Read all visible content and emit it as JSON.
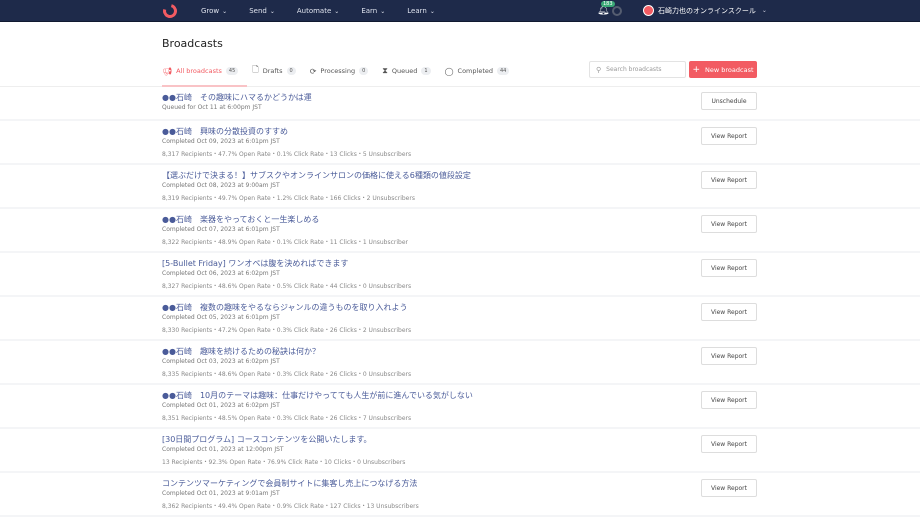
{
  "nav": {
    "items": [
      "Grow",
      "Send",
      "Automate",
      "Earn",
      "Learn"
    ],
    "notification_count": "183",
    "user_name": "石崎力也のオンラインスクール"
  },
  "page": {
    "title": "Broadcasts"
  },
  "tabs": [
    {
      "label": "All broadcasts",
      "count": "45",
      "icon": "megaphone-icon"
    },
    {
      "label": "Drafts",
      "count": "0",
      "icon": "document-icon"
    },
    {
      "label": "Processing",
      "count": "0",
      "icon": "refresh-icon"
    },
    {
      "label": "Queued",
      "count": "1",
      "icon": "hourglass-icon"
    },
    {
      "label": "Completed",
      "count": "44",
      "icon": "check-circle-icon"
    }
  ],
  "search": {
    "placeholder": "Search broadcasts"
  },
  "new_button": "New broadcast",
  "accent": "#f25b62",
  "broadcasts": [
    {
      "title": "●●石崎　その趣味にハマるかどうかは運",
      "status": "Queued for Oct 11 at 6:00pm JST",
      "stats": "",
      "action": "Unschedule"
    },
    {
      "title": "●●石崎　興味の分散投資のすすめ",
      "status": "Completed Oct 09, 2023 at 6:01pm JST",
      "stats": "8,317 Recipients・47.7% Open Rate・0.1% Click Rate・13 Clicks・5 Unsubscribers",
      "action": "View Report"
    },
    {
      "title": "【選ぶだけで決まる！】サブスクやオンラインサロンの価格に使える6種類の値段設定",
      "status": "Completed Oct 08, 2023 at 9:00am JST",
      "stats": "8,319 Recipients・49.7% Open Rate・1.2% Click Rate・166 Clicks・2 Unsubscribers",
      "action": "View Report"
    },
    {
      "title": "●●石崎　楽器をやっておくと一生楽しめる",
      "status": "Completed Oct 07, 2023 at 6:01pm JST",
      "stats": "8,322 Recipients・48.9% Open Rate・0.1% Click Rate・11 Clicks・1 Unsubscriber",
      "action": "View Report"
    },
    {
      "title": "[5-Bullet Friday] ワンオペは腹を決めればできます",
      "status": "Completed Oct 06, 2023 at 6:02pm JST",
      "stats": "8,327 Recipients・48.6% Open Rate・0.5% Click Rate・44 Clicks・0 Unsubscribers",
      "action": "View Report"
    },
    {
      "title": "●●石崎　複数の趣味をやるならジャンルの違うものを取り入れよう",
      "status": "Completed Oct 05, 2023 at 6:01pm JST",
      "stats": "8,330 Recipients・47.2% Open Rate・0.3% Click Rate・26 Clicks・2 Unsubscribers",
      "action": "View Report"
    },
    {
      "title": "●●石崎　趣味を続けるための秘訣は何か？",
      "status": "Completed Oct 03, 2023 at 6:02pm JST",
      "stats": "8,335 Recipients・48.6% Open Rate・0.3% Click Rate・26 Clicks・0 Unsubscribers",
      "action": "View Report"
    },
    {
      "title": "●●石崎　10月のテーマは趣味：仕事だけやってても人生が前に進んでいる気がしない",
      "status": "Completed Oct 01, 2023 at 6:02pm JST",
      "stats": "8,351 Recipients・48.5% Open Rate・0.3% Click Rate・26 Clicks・7 Unsubscribers",
      "action": "View Report"
    },
    {
      "title": "[30日間プログラム] コースコンテンツを公開いたします。",
      "status": "Completed Oct 01, 2023 at 12:00pm JST",
      "stats": "13 Recipients・92.3% Open Rate・76.9% Click Rate・10 Clicks・0 Unsubscribers",
      "action": "View Report"
    },
    {
      "title": "コンテンツマーケティングで会員制サイトに集客し売上につなげる方法",
      "status": "Completed Oct 01, 2023 at 9:01am JST",
      "stats": "8,362 Recipients・49.4% Open Rate・0.9% Click Rate・127 Clicks・13 Unsubscribers",
      "action": "View Report"
    }
  ]
}
